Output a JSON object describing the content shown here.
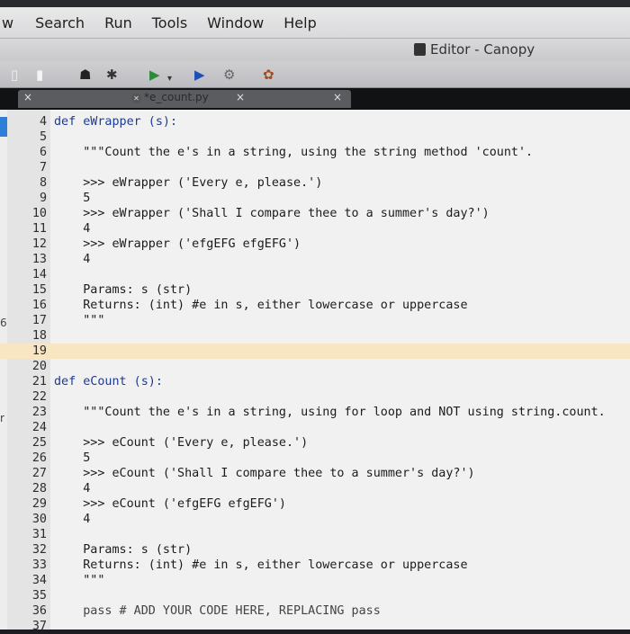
{
  "menubar": {
    "items": [
      "w",
      "Search",
      "Run",
      "Tools",
      "Window",
      "Help"
    ]
  },
  "titlebar": {
    "title": "Editor - Canopy"
  },
  "toolbar": {
    "icons": [
      "new-file-icon",
      "open-file-icon",
      "binoculars-icon",
      "debug-icon",
      "run-icon",
      "run-dropdown-icon",
      "play-icon",
      "gear-icon",
      "package-icon"
    ]
  },
  "tabs": [
    {
      "label": "",
      "close": "×"
    },
    {
      "label": "*e_count.py",
      "close": "×",
      "active": true
    },
    {
      "label": "",
      "close": "×"
    }
  ],
  "margin_marks": {
    "m1": "6",
    "m2": "r"
  },
  "lines": [
    {
      "n": "4",
      "t": "def eWrapper (s):"
    },
    {
      "n": "5",
      "t": ""
    },
    {
      "n": "6",
      "t": "    \"\"\"Count the e's in a string, using the string method 'count'."
    },
    {
      "n": "7",
      "t": ""
    },
    {
      "n": "8",
      "t": "    >>> eWrapper ('Every e, please.')"
    },
    {
      "n": "9",
      "t": "    5"
    },
    {
      "n": "10",
      "t": "    >>> eWrapper ('Shall I compare thee to a summer's day?')"
    },
    {
      "n": "11",
      "t": "    4"
    },
    {
      "n": "12",
      "t": "    >>> eWrapper ('efgEFG efgEFG')"
    },
    {
      "n": "13",
      "t": "    4"
    },
    {
      "n": "14",
      "t": ""
    },
    {
      "n": "15",
      "t": "    Params: s (str)"
    },
    {
      "n": "16",
      "t": "    Returns: (int) #e in s, either lowercase or uppercase"
    },
    {
      "n": "17",
      "t": "    \"\"\""
    },
    {
      "n": "18",
      "t": ""
    },
    {
      "n": "19",
      "t": ""
    },
    {
      "n": "20",
      "t": ""
    },
    {
      "n": "21",
      "t": "def eCount (s):"
    },
    {
      "n": "22",
      "t": ""
    },
    {
      "n": "23",
      "t": "    \"\"\"Count the e's in a string, using for loop and NOT using string.count."
    },
    {
      "n": "24",
      "t": ""
    },
    {
      "n": "25",
      "t": "    >>> eCount ('Every e, please.')"
    },
    {
      "n": "26",
      "t": "    5"
    },
    {
      "n": "27",
      "t": "    >>> eCount ('Shall I compare thee to a summer's day?')"
    },
    {
      "n": "28",
      "t": "    4"
    },
    {
      "n": "29",
      "t": "    >>> eCount ('efgEFG efgEFG')"
    },
    {
      "n": "30",
      "t": "    4"
    },
    {
      "n": "31",
      "t": ""
    },
    {
      "n": "32",
      "t": "    Params: s (str)"
    },
    {
      "n": "33",
      "t": "    Returns: (int) #e in s, either lowercase or uppercase"
    },
    {
      "n": "34",
      "t": "    \"\"\""
    },
    {
      "n": "35",
      "t": ""
    },
    {
      "n": "36",
      "t": "    pass # ADD YOUR CODE HERE, REPLACING pass"
    },
    {
      "n": "37",
      "t": ""
    }
  ],
  "highlight_line": "19",
  "colors": {
    "highlight": "#f8e6c2",
    "accent": "#2f7fd8"
  }
}
